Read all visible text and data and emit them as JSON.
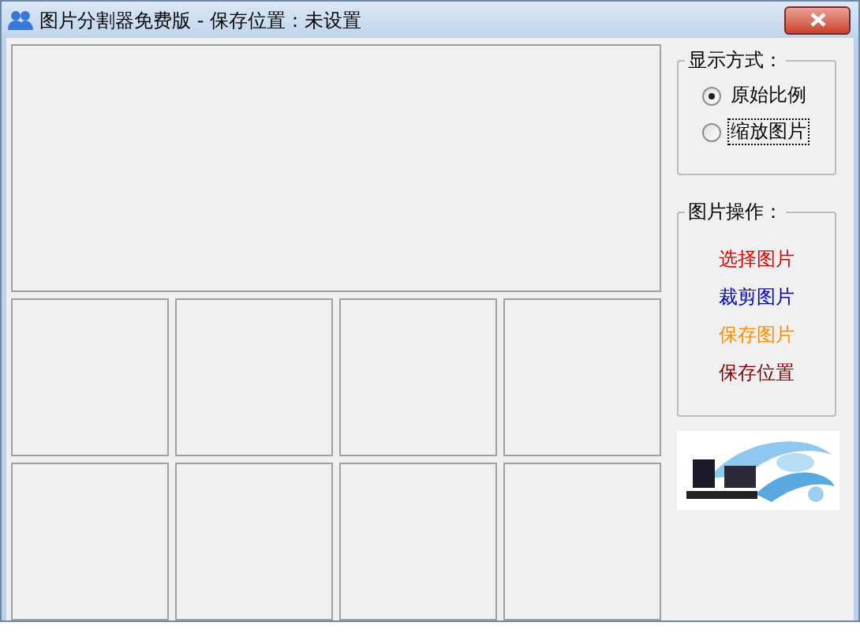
{
  "window": {
    "title": "图片分割器免费版 - 保存位置：未设置"
  },
  "display_mode": {
    "title": "显示方式：",
    "options": [
      {
        "label": "原始比例",
        "selected": true,
        "focused": false
      },
      {
        "label": "缩放图片",
        "selected": false,
        "focused": true
      }
    ]
  },
  "image_actions": {
    "title": "图片操作：",
    "links": [
      {
        "label": "选择图片",
        "color": "#e00000"
      },
      {
        "label": "裁剪图片",
        "color": "#0000c8"
      },
      {
        "label": "保存图片",
        "color": "#ff8c00"
      },
      {
        "label": "保存位置",
        "color": "#800000"
      }
    ]
  }
}
